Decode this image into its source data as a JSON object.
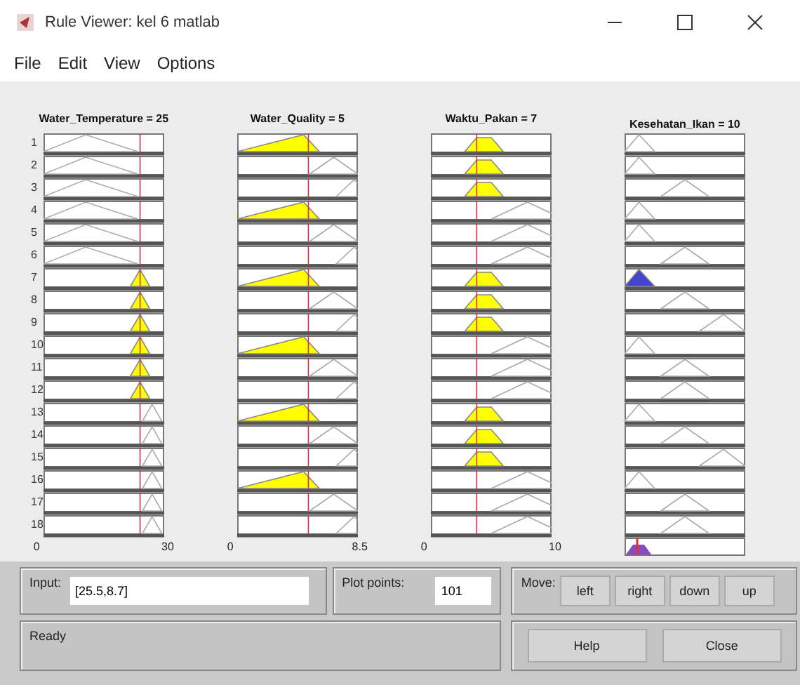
{
  "window": {
    "title": "Rule Viewer: kel 6 matlab"
  },
  "menu": [
    {
      "label": "File"
    },
    {
      "label": "Edit"
    },
    {
      "label": "View"
    },
    {
      "label": "Options"
    }
  ],
  "rules": [
    "1",
    "2",
    "3",
    "4",
    "5",
    "6",
    "7",
    "8",
    "9",
    "10",
    "11",
    "12",
    "13",
    "14",
    "15",
    "16",
    "17",
    "18"
  ],
  "variables": [
    {
      "label": "Water_Temperature = 25",
      "kind": "input",
      "axis_min": "0",
      "axis_max": "30"
    },
    {
      "label": "Water_Quality = 5",
      "kind": "input",
      "axis_min": "0",
      "axis_max": "8.5"
    },
    {
      "label": "Waktu_Pakan = 7",
      "kind": "input",
      "axis_min": "0",
      "axis_max": "10"
    },
    {
      "label": "Kesehatan_Ikan = 10",
      "kind": "output"
    }
  ],
  "input": {
    "label": "Input:",
    "value": "[25.5,8.7]"
  },
  "plot_points": {
    "label": "Plot points:",
    "value": "101"
  },
  "move": {
    "label": "Move:",
    "buttons": [
      "left",
      "right",
      "down",
      "up"
    ]
  },
  "status": "Ready",
  "buttons": [
    "Help",
    "Close"
  ]
}
